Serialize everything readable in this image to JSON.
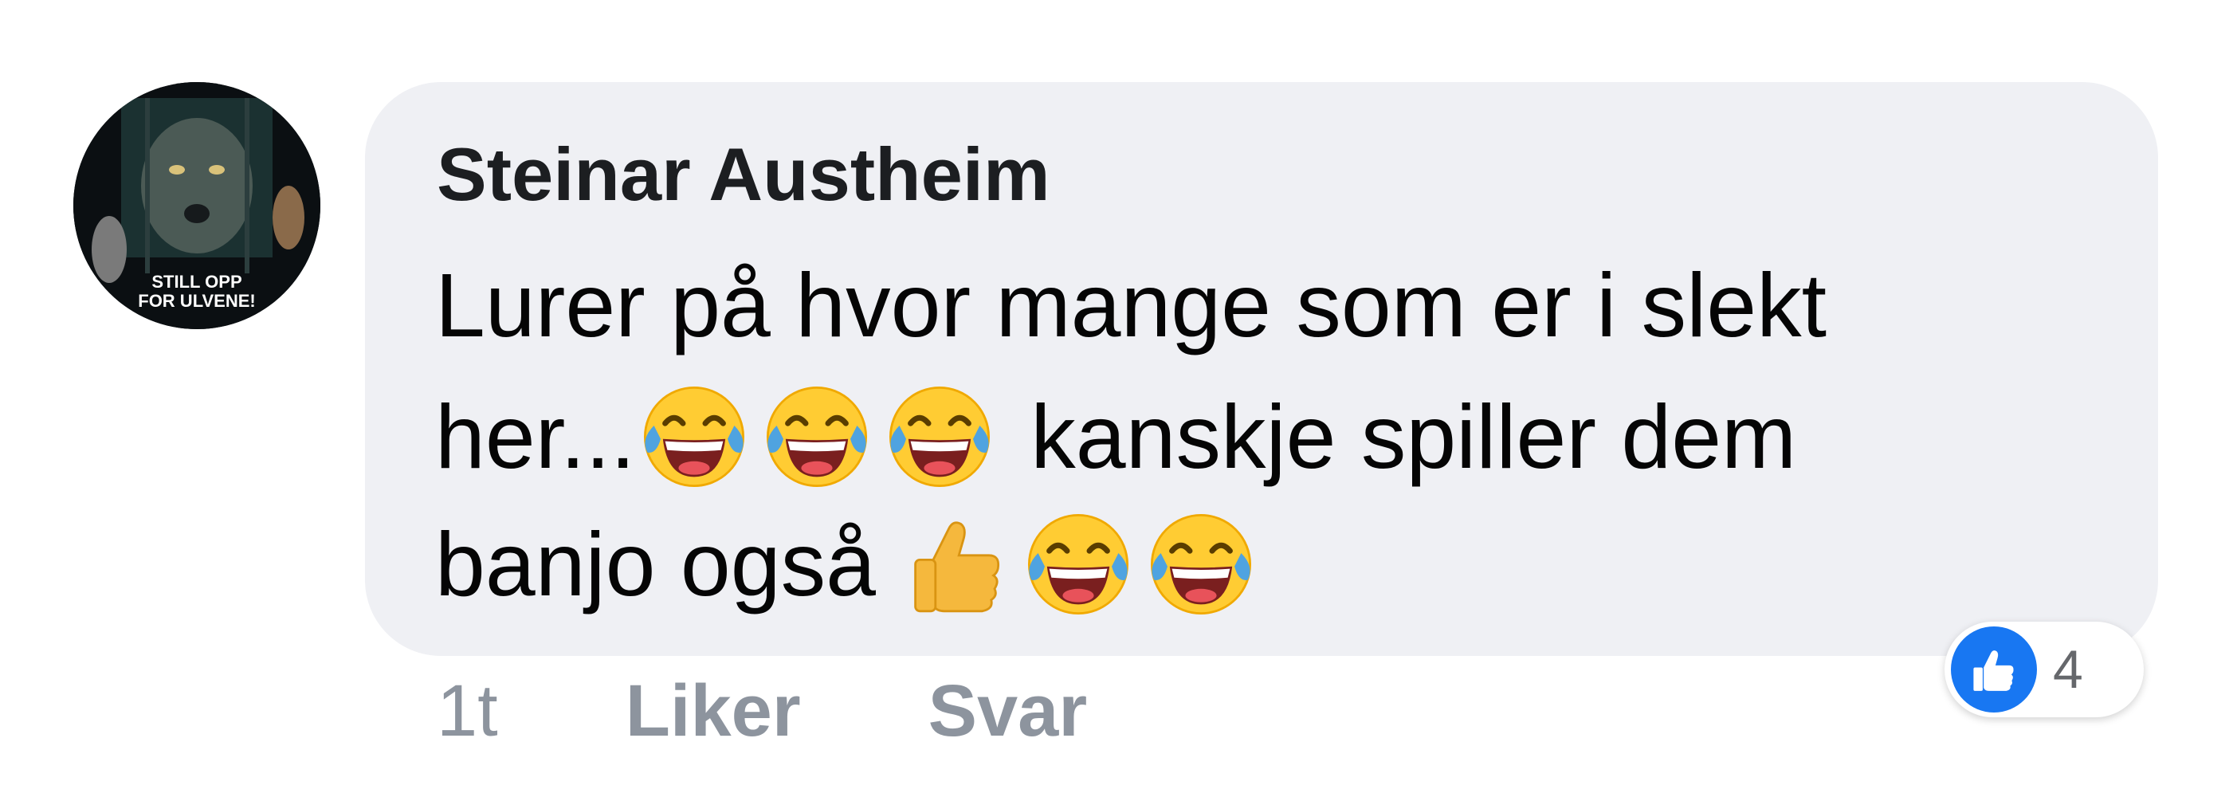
{
  "comment": {
    "author": "Steinar Austheim",
    "avatar": {
      "text_line1": "STILL OPP",
      "text_line2": "FOR ULVENE!"
    },
    "lines": {
      "line1": "Lurer på hvor mange som er i slekt",
      "line2_start": "her...",
      "line2_end": "kanskje spiller dem",
      "line3_start": "banjo også"
    },
    "emoji_names": {
      "laughing": "face-with-tears-of-joy-icon",
      "thumbs_up": "thumbs-up-icon"
    },
    "actions": {
      "time": "1t",
      "like": "Liker",
      "reply": "Svar"
    },
    "reactions": {
      "icon": "like-reaction-icon",
      "color": "#1877f2",
      "count": "4"
    }
  },
  "colors": {
    "bubble": "#eff0f4",
    "action_text": "#8d949e",
    "author_text": "#1c1e21"
  }
}
